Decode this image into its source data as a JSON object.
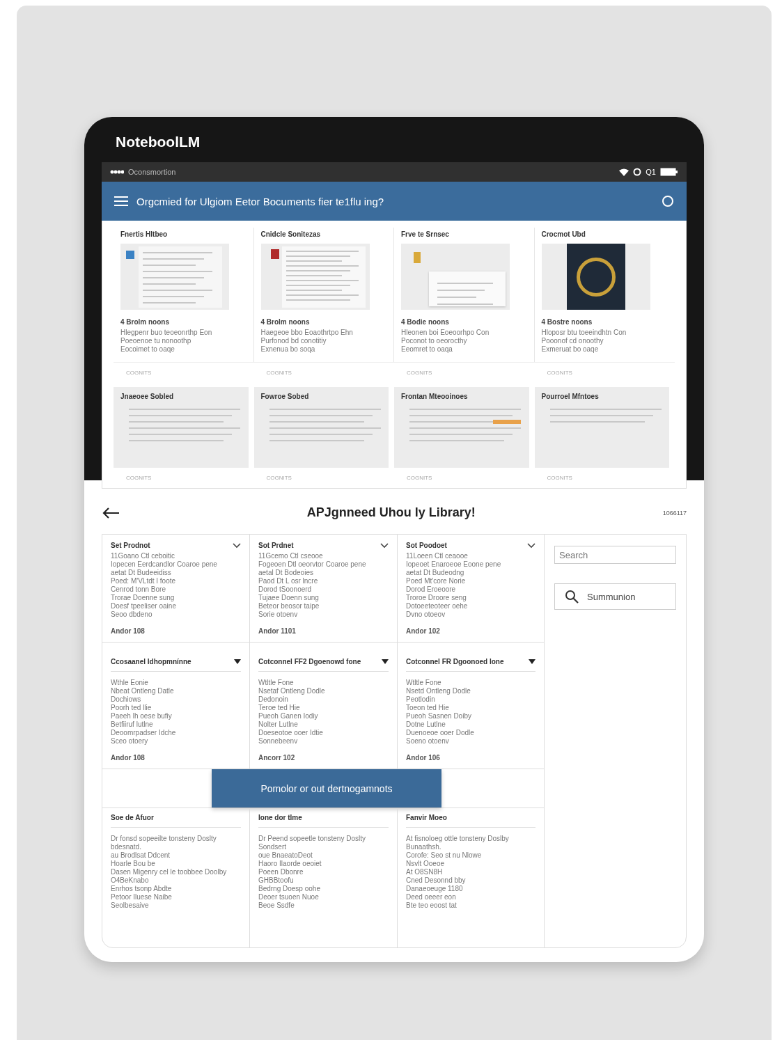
{
  "app_title": "NoteboolLM",
  "status_bar": {
    "carrier": "Oconsmortion",
    "clock": "Q1"
  },
  "header": {
    "title": "Orgcmied for Ulgiom Eetor Bocuments fier te1flu ing?"
  },
  "summary_cards": [
    {
      "title": "Fnertis Hltbeo",
      "kind": "form",
      "subtitle": "4 Brolm noons",
      "lines": [
        "Hlegpenr buo teoeonrthp Eon",
        "Poeoenoe tu nonoothp",
        "Eocoimet to oaqe"
      ],
      "footer": "COGNITS"
    },
    {
      "title": "Cnidcle Sonitezas",
      "kind": "letter",
      "subtitle": "4 Brolm noons",
      "lines": [
        "Haegeoe bbo Eoaothrtpo Ehn",
        "Purfonod bd conotitiy",
        "Exnenua bo soqa"
      ],
      "footer": "COGNITS"
    },
    {
      "title": "Frve te Srnsec",
      "kind": "dialog",
      "subtitle": "4 Bodie noons",
      "lines": [
        "Hleonen boi Eoeoorhpo Con",
        "Poconot to oeorocthy",
        "Eeomret to oaqa"
      ],
      "footer": "COGNITS"
    },
    {
      "title": "Crocmot Ubd",
      "kind": "photo",
      "subtitle": "4 Bostre noons",
      "lines": [
        "Hloposr btu toeeindhtn Con",
        "Pooonof cd onoothy",
        "Exmeruat bo oaqe"
      ],
      "footer": "COGNITS"
    }
  ],
  "note_cards": [
    {
      "title": "Jnaeoee Sobled",
      "footer": "COGNITS"
    },
    {
      "title": "Fowroe Sobed",
      "footer": "COGNITS"
    },
    {
      "title": "Frontan Mteooinoes",
      "footer": "COGNITS"
    },
    {
      "title": "Pourroel Mfntoes",
      "footer": "COGNITS"
    }
  ],
  "library": {
    "title": "APJgnneed Uhou ly Library!",
    "count": "1066117"
  },
  "products": [
    {
      "title": "Set Prodnot",
      "lines": [
        "11Goano Ctl ceboitic",
        "Iopecen Eerdcandlor Coaroe pene",
        "aetat Dt Budeeidiss",
        "Poed: M'VLtdt I foote",
        "Cenrod tonn Bore",
        "Trorae Doenne sung",
        "Doesf tpeeliser oaine",
        "Seoo dbdeno"
      ],
      "footer": "Andor 108"
    },
    {
      "title": "Sot Prdnet",
      "lines": [
        "11Gcemo Ctl cseooe",
        "Fogeoen Dtl oeorvtor Coaroe pene",
        "aetal Dt Bodeoies",
        "Paod Dt L osr lncre",
        "Dorod tSoonoerd",
        "Tujaee Doenn sung",
        "Beteor beosor taipe",
        "Sorie otoenv"
      ],
      "footer": "Andor 1101"
    },
    {
      "title": "Sot Poodoet",
      "lines": [
        "11Loeen Ctl ceaooe",
        "Iopeoet Enaroeoe Eoone pene",
        "aetat Dt Budeodng",
        "Poed Mt'core Norie",
        "Dorod Eroeoore",
        "Troroe Droore seng",
        "Dotoeeteoteer oehe",
        "Dvno otoeov"
      ],
      "footer": "Andor 102"
    }
  ],
  "categories": [
    {
      "title": "Ccosaanel Idhopmnínne",
      "lines": [
        "Wthle Eonie",
        "Nbeat Ontleng Datle",
        "Dochiows",
        "Poorh ted llie",
        "Paeeh lh oese bufiy",
        "Betfiiruf lutlne",
        "Deoomrpadser Idche",
        "Sceo otoery"
      ],
      "footer": "Andor 108"
    },
    {
      "title": "Cotconnel FF2 Dgoenowd fone",
      "lines": [
        "Wtltle Fone",
        "Nsetaf Ontleng Dodle",
        "Dedonoin",
        "Teroe ted Hie",
        "Pueoh Ganen Iodiy",
        "Nolter Lutlne",
        "Doeseotoe ooer Idtie",
        "Sonnebeenv"
      ],
      "footer": "Ancorr 102"
    },
    {
      "title": "Cotconnel FR Dgoonoed lone",
      "lines": [
        "Wtltle Fone",
        "Nsetd Ontleng Dodle",
        "Peotlodin",
        "Toeon ted Hie",
        "Pueoh Sasnen Doiby",
        "Dotne Lutlne",
        "Duenoeoe ooer Dodle",
        "Soeno otoenv"
      ],
      "footer": "Andor 106"
    }
  ],
  "banner_button": "Pomolor or out dertnogamnots",
  "columns": [
    {
      "title": "Soe de Afuor",
      "lines": [
        "Dr fonsd sopeeilte tonsteny Doslty bdesnatd.",
        "au Brodlsat Ddcent",
        "Hoarle Bou be",
        "Dasen Migenry cel le toobbee Doolby",
        "O4BeKnabo",
        "Enrhos tsonp Abdte",
        "Petoor Iluese Naibe",
        "Seolbesaive"
      ]
    },
    {
      "title": "Ione dor tlme",
      "lines": [
        "Dr Peend sopeetle tonsteny Doslty Sondsert",
        "oue BnaeatoDeot",
        "Haoro Ilaorde oeoiet",
        "Poeen Dbonre",
        "GHBBtoofu",
        "Bedrng Doesp oohe",
        "Deoer tsuoen Nuoe",
        "Beoe Ssdfe"
      ]
    },
    {
      "title": "Fanvir Moeo",
      "lines": [
        "At fisnoloeg ottle tonsteny Doslby Bunaathsh.",
        "Corofe: Seo st nu Nlowe",
        "Nsvlt Ooeoe",
        "At O8SN8H",
        "Cned Desonnd bby",
        "Danaeoeuge 1180",
        "Deed oeeer eon",
        "Bte teo eoost tat"
      ]
    }
  ],
  "sidebar": {
    "search_placeholder": "Search",
    "button": "Summunion"
  }
}
